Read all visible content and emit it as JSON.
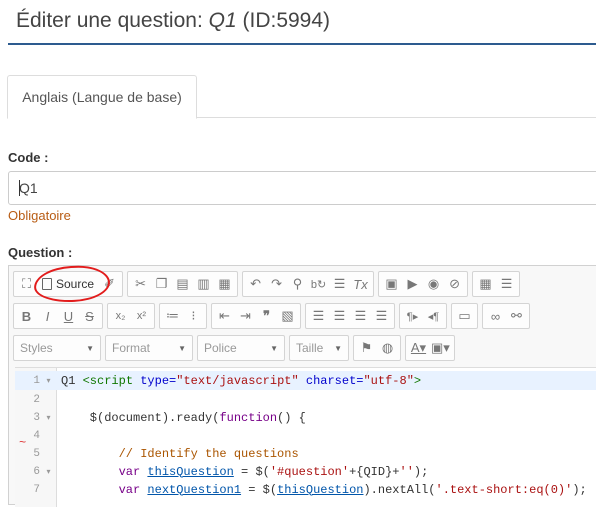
{
  "header": {
    "title_prefix": "Éditer une question:",
    "question_code": "Q1",
    "question_id": "(ID:5994)"
  },
  "tabs": [
    {
      "label": "Anglais (Langue de base)",
      "active": true
    }
  ],
  "code_field": {
    "label": "Code :",
    "value": "Q1",
    "required_note": "Obligatoire"
  },
  "question_field": {
    "label": "Question :"
  },
  "toolbar": {
    "source_label": "Source",
    "combos": {
      "styles": "Styles",
      "format": "Format",
      "font": "Police",
      "size": "Taille"
    }
  },
  "code_lines": [
    {
      "num": "1",
      "fold": "▾",
      "active": true
    },
    {
      "num": "2",
      "fold": ""
    },
    {
      "num": "3",
      "fold": "▾"
    },
    {
      "num": "4",
      "fold": ""
    },
    {
      "num": "5",
      "fold": ""
    },
    {
      "num": "6",
      "fold": "▾"
    },
    {
      "num": "7",
      "fold": ""
    }
  ],
  "code_text": {
    "l1": {
      "a": "Q1 ",
      "b": "<script",
      "c": " type=",
      "d": "\"text/javascript\"",
      "e": " charset=",
      "f": "\"utf-8\"",
      "g": ">"
    },
    "l3": {
      "a": "    $(document).ready(",
      "b": "function",
      "c": "() {"
    },
    "l5": {
      "a": "        ",
      "b": "// Identify the questions"
    },
    "l6": {
      "a": "        ",
      "b": "var",
      "c": " ",
      "d": "thisQuestion",
      "e": " = $(",
      "f": "'#question'",
      "g": "+{QID}+",
      "h": "''",
      "i": ");"
    },
    "l7": {
      "a": "        ",
      "b": "var",
      "c": " ",
      "d": "nextQuestion1",
      "e": " = $(",
      "f": "thisQuestion",
      "g": ").nextAll(",
      "h": "'.text-short:eq(0)'",
      "i": ");"
    }
  },
  "colors": {
    "accent_rule": "#2d5b8f",
    "required": "#b85c14",
    "annotation": "#e21c1c"
  }
}
